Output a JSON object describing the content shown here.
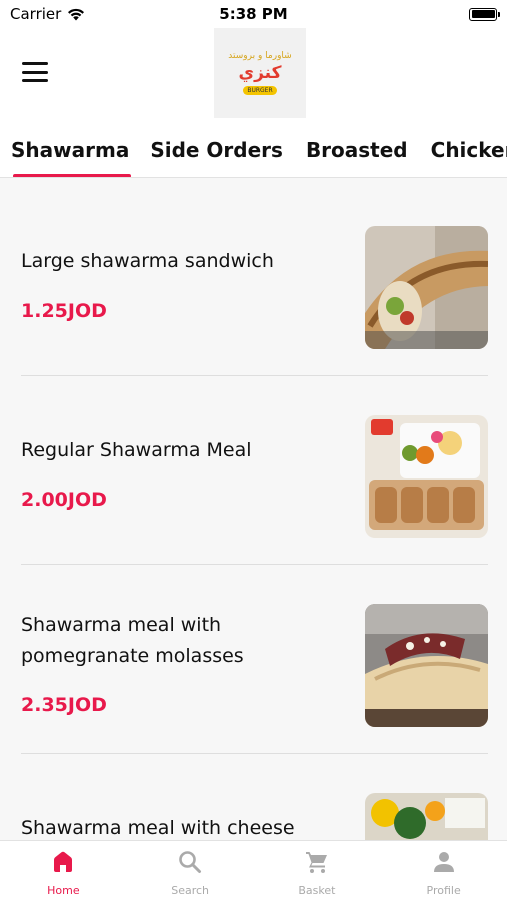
{
  "status_bar": {
    "carrier": "Carrier",
    "time": "5:38 PM"
  },
  "header": {
    "logo": {
      "arabic_text": "كنزي",
      "arabic_sub": "شاورما و بروستد",
      "badge": "BURGER"
    }
  },
  "tabs": [
    {
      "label": "Shawarma",
      "active": true
    },
    {
      "label": "Side Orders",
      "active": false
    },
    {
      "label": "Broasted",
      "active": false
    },
    {
      "label": "Chicken burger",
      "active": false
    }
  ],
  "items": [
    {
      "name": "Large shawarma sandwich",
      "price": "1.25JOD"
    },
    {
      "name": "Regular Shawarma Meal",
      "price": "2.00JOD"
    },
    {
      "name": "Shawarma meal with pomegranate molasses",
      "price": "2.35JOD"
    },
    {
      "name": "Shawarma meal with cheese",
      "price": ""
    }
  ],
  "tabbar": [
    {
      "label": "Home",
      "icon": "home-icon",
      "active": true
    },
    {
      "label": "Search",
      "icon": "search-icon",
      "active": false
    },
    {
      "label": "Basket",
      "icon": "cart-icon",
      "active": false
    },
    {
      "label": "Profile",
      "icon": "person-icon",
      "active": false
    }
  ],
  "colors": {
    "accent": "#e8194b",
    "inactive": "#aaaaaa"
  }
}
